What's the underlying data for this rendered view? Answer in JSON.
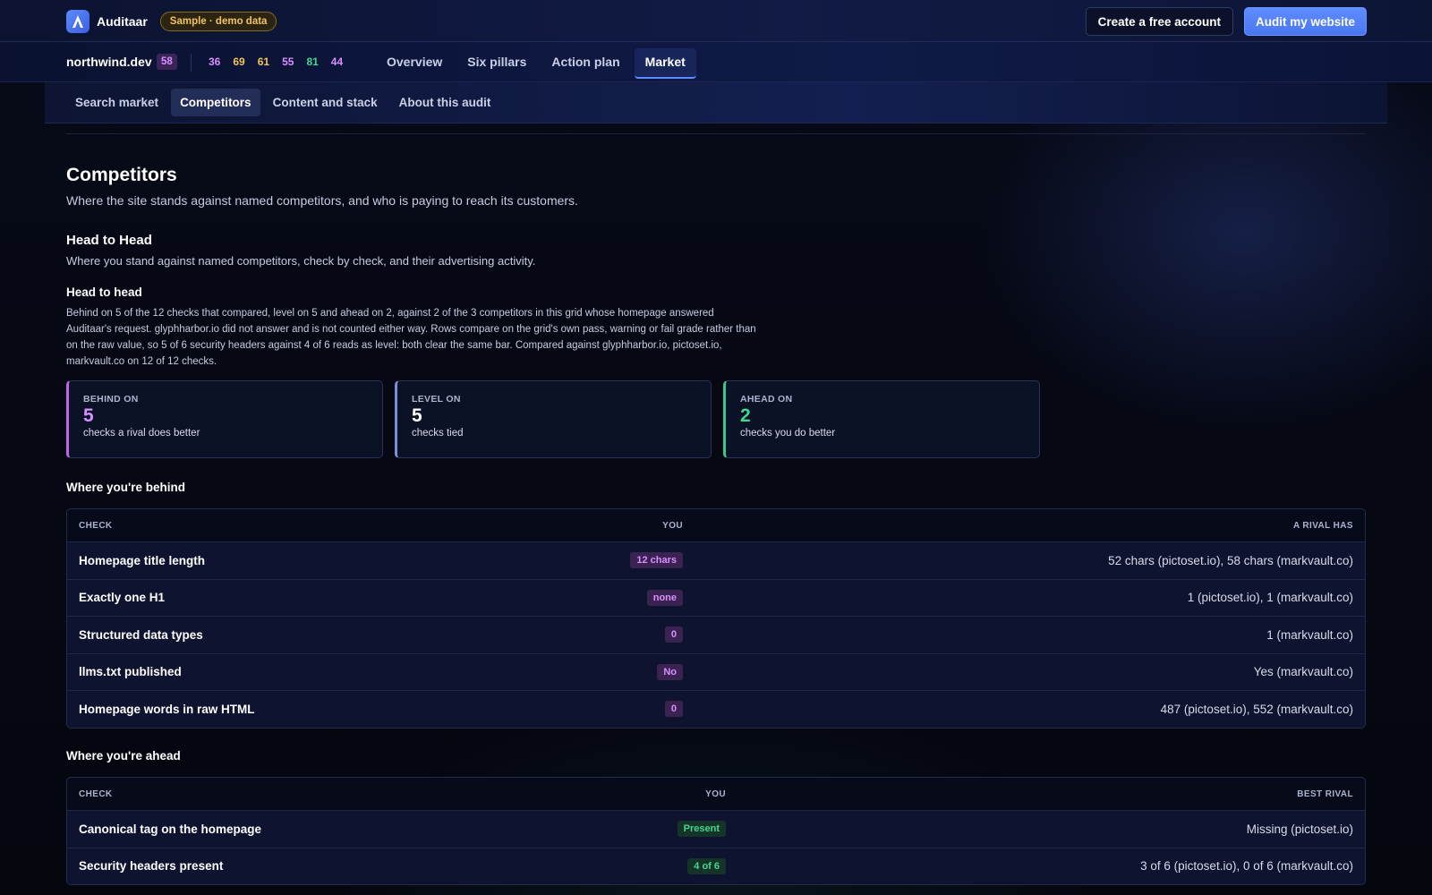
{
  "header": {
    "brand": "Auditaar",
    "sample_badge": "Sample · demo data",
    "create_account": "Create a free account",
    "audit_button": "Audit my website"
  },
  "site": {
    "name": "northwind.dev",
    "score": "58",
    "pillar_scores": [
      {
        "value": "36",
        "color": "#d690ff"
      },
      {
        "value": "69",
        "color": "#f3c45a"
      },
      {
        "value": "61",
        "color": "#f3c45a"
      },
      {
        "value": "55",
        "color": "#d690ff"
      },
      {
        "value": "81",
        "color": "#43d68e"
      },
      {
        "value": "44",
        "color": "#d690ff"
      }
    ],
    "nav": [
      "Overview",
      "Six pillars",
      "Action plan",
      "Market"
    ],
    "nav_active": "Market"
  },
  "subnav": {
    "tabs": [
      "Search market",
      "Competitors",
      "Content and stack",
      "About this audit"
    ],
    "active": "Competitors"
  },
  "page": {
    "title": "Competitors",
    "subtitle": "Where the site stands against named competitors, and who is paying to reach its customers.",
    "section_title": "Head to Head",
    "section_subtitle": "Where you stand against named competitors, check by check, and their advertising activity.",
    "h2h_title": "Head to head",
    "h2h_body": "Behind on 5 of the 12 checks that compared, level on 5 and ahead on 2, against 2 of the 3 competitors in this grid whose homepage answered Auditaar's request. glyphharbor.io did not answer and is not counted either way. Rows compare on the grid's own pass, warning or fail grade rather than on the raw value, so 5 of 6 security headers against 4 of 6 reads as level: both clear the same bar. Compared against glyphharbor.io, pictoset.io, markvault.co on 12 of 12 checks."
  },
  "stats": [
    {
      "label": "BEHIND ON",
      "value": "5",
      "note": "checks a rival does better",
      "color": "#d690ff"
    },
    {
      "label": "LEVEL ON",
      "value": "5",
      "note": "checks tied",
      "color": "#ffffff"
    },
    {
      "label": "AHEAD ON",
      "value": "2",
      "note": "checks you do better",
      "color": "#43d68e"
    }
  ],
  "behind": {
    "heading": "Where you're behind",
    "columns": [
      "CHECK",
      "YOU",
      "A RIVAL HAS"
    ],
    "rows": [
      {
        "check": "Homepage title length",
        "you": "12 chars",
        "rival": "52 chars (pictoset.io), 58 chars (markvault.co)"
      },
      {
        "check": "Exactly one H1",
        "you": "none",
        "rival": "1 (pictoset.io), 1 (markvault.co)"
      },
      {
        "check": "Structured data types",
        "you": "0",
        "rival": "1 (markvault.co)"
      },
      {
        "check": "llms.txt published",
        "you": "No",
        "rival": "Yes (markvault.co)"
      },
      {
        "check": "Homepage words in raw HTML",
        "you": "0",
        "rival": "487 (pictoset.io), 552 (markvault.co)"
      }
    ]
  },
  "ahead": {
    "heading": "Where you're ahead",
    "columns": [
      "CHECK",
      "YOU",
      "BEST RIVAL"
    ],
    "rows": [
      {
        "check": "Canonical tag on the homepage",
        "you": "Present",
        "rival": "Missing (pictoset.io)"
      },
      {
        "check": "Security headers present",
        "you": "4 of 6",
        "rival": "3 of 6 (pictoset.io), 0 of 6 (markvault.co)"
      }
    ]
  }
}
